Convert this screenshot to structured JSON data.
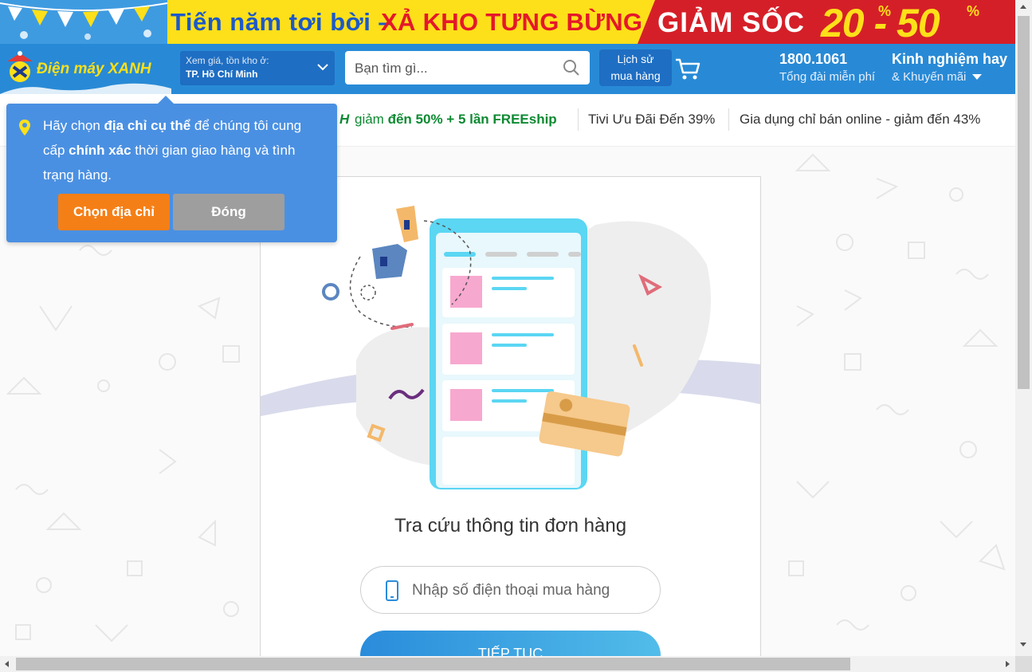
{
  "banner": {
    "left_text": "Tiến năm tơi bời –",
    "mid_text": "XẢ KHO TƯNG BỪNG",
    "sale_text": "GIẢM SỐC",
    "sale_range": "20 - 50",
    "percent_sign": "%",
    "colors": {
      "background": "#fde019",
      "blue_text": "#1d59c8",
      "red": "#e5172a",
      "sale_panel": "#d51f28"
    }
  },
  "header": {
    "logo_text": "Điện máy XANH",
    "location": {
      "label": "Xem giá, tồn kho ở:",
      "value": "TP. Hồ Chí Minh"
    },
    "search": {
      "placeholder": "Bạn tìm gì..."
    },
    "history_button": {
      "line1": "Lịch sử",
      "line2": "mua hàng"
    },
    "hotline": {
      "number": "1800.1061",
      "label": "Tổng đài miễn phí"
    },
    "experience": {
      "title": "Kinh nghiệm hay",
      "subtitle": "& Khuyến mãi"
    },
    "colors": {
      "background": "#288ad6",
      "dark_button": "#1e6ec3"
    }
  },
  "subnav": {
    "item1_prefix": "H",
    "item1_text": "giảm",
    "item1_bold": "đến 50% + 5 lần FREEship",
    "item2": "Tivi Ưu Đãi Đến 39%",
    "item3": "Gia dụng chỉ bán online - giảm đến 43%"
  },
  "popup": {
    "message_part1": "Hãy chọn ",
    "message_bold1": "địa chỉ cụ thể",
    "message_part2": " để chúng tôi cung cấp ",
    "message_bold2": "chính xác",
    "message_part3": " thời gian giao hàng và tình trạng hàng.",
    "choose_button": "Chọn địa chỉ",
    "close_button": "Đóng",
    "colors": {
      "background": "#4a90e2",
      "choose": "#f57f17",
      "close": "#9e9e9e",
      "pin": "#fde019"
    }
  },
  "lookup": {
    "title": "Tra cứu thông tin đơn hàng",
    "phone_placeholder": "Nhập số điện thoại mua hàng",
    "continue_button": "TIẾP TỤC"
  },
  "icons": [
    "search-icon",
    "chevron-down-icon",
    "cart-icon",
    "caret-down-icon",
    "location-pin-icon",
    "phone-icon",
    "logo-icon"
  ]
}
